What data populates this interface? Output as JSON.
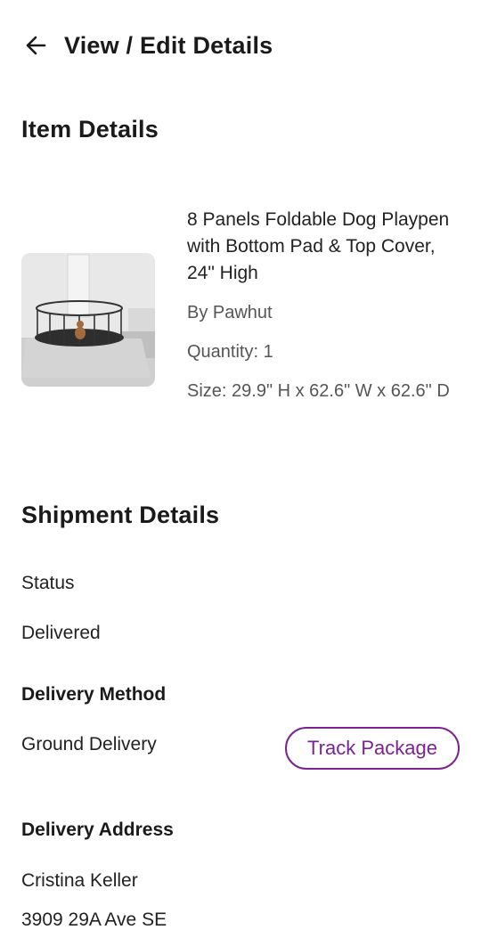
{
  "header": {
    "title": "View / Edit Details",
    "back_icon": "arrow-left-icon"
  },
  "item_section": {
    "title": "Item Details",
    "item": {
      "name": "8 Panels Foldable Dog Playpen with Bottom Pad & Top Cover, 24\" High",
      "brand": "By Pawhut",
      "quantity": "Quantity: 1",
      "size": "Size: 29.9\" H x 62.6\" W x 62.6\" D"
    }
  },
  "shipment_section": {
    "title": "Shipment Details",
    "status_label": "Status",
    "status_value": "Delivered",
    "delivery_method_label": "Delivery Method",
    "delivery_method_value": "Ground Delivery",
    "track_button_label": "Track Package",
    "delivery_address_label": "Delivery Address",
    "address_name": "Cristina Keller",
    "address_line1": "3909 29A Ave SE"
  },
  "colors": {
    "accent": "#7b2490",
    "text": "#1a1a1a",
    "muted": "#555555"
  }
}
